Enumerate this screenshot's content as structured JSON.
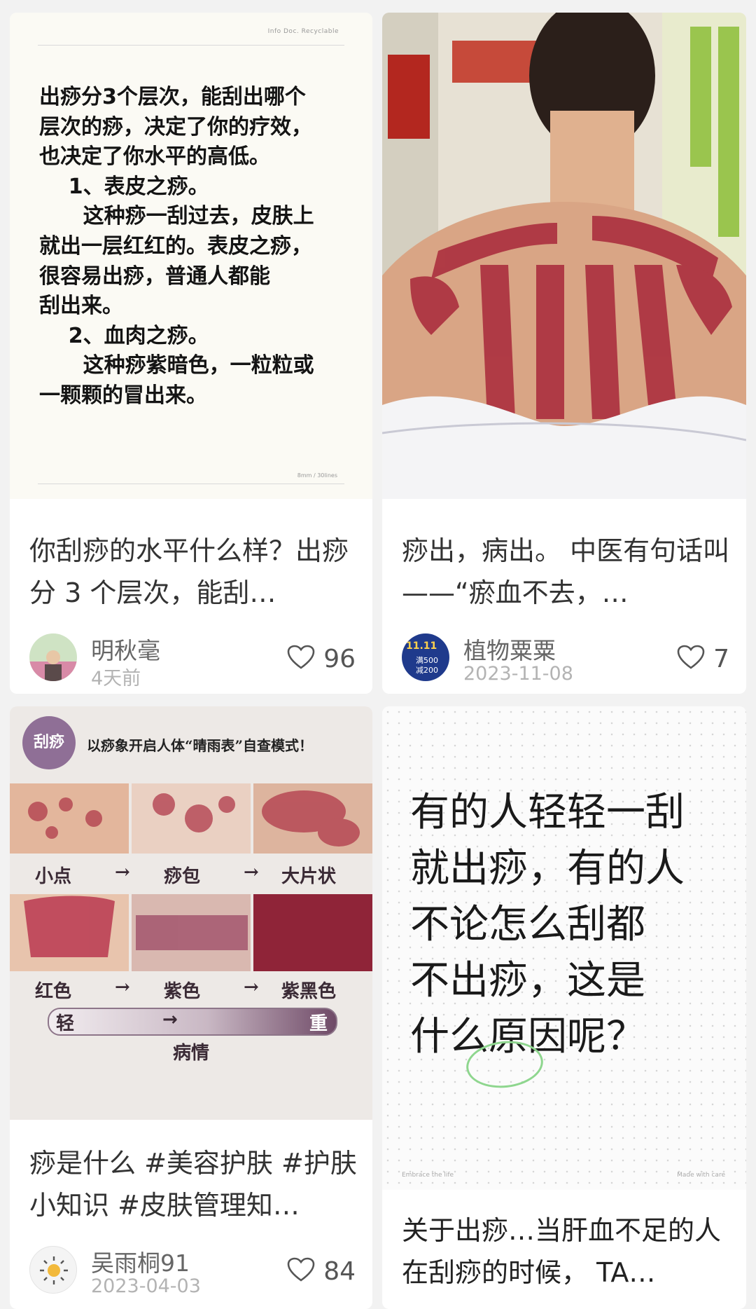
{
  "feed": [
    {
      "note_text": "出痧分3个层次，能刮出哪个\n层次的痧，决定了你的疗效，\n也决定了你水平的高低。\n    1、表皮之痧。\n      这种痧一刮过去，皮肤上\n就出一层红红的。表皮之痧，\n很容易出痧，普通人都能\n刮出来。\n    2、血肉之痧。\n      这种痧紫暗色，一粒粒或\n一颗颗的冒出来。",
      "note_top_label": "Info Doc.   Recyclable",
      "note_bottom_label": "8mm / 30lines",
      "caption": "你刮痧的水平什么样？出痧分 3 个层次，能刮…",
      "author": "明秋毫",
      "date": "4天前",
      "likes": "96"
    },
    {
      "caption": "痧出，病出。 中医有句话叫——“瘀血不去，…",
      "author": "植物粟粟",
      "date": "2023-11-08",
      "likes": "7",
      "avatar_text_1": "11.11",
      "avatar_text_2": "满500",
      "avatar_text_3": "减200"
    },
    {
      "seal_text": "刮痧",
      "info_title": "以痧象开启人体“晴雨表”自查模式！",
      "row1_labels": [
        "小点",
        "→",
        "痧包",
        "→",
        "大片状"
      ],
      "row2_labels": [
        "红色",
        "→",
        "紫色",
        "→",
        "紫黑色"
      ],
      "bar_left": "轻",
      "bar_arrow": "→",
      "bar_right": "重",
      "bar_caption": "病情",
      "caption": "痧是什么 #美容护肤 #护肤小知识 #皮肤管理知…",
      "author": "吴雨桐91",
      "date": "2023-04-03",
      "likes": "84"
    },
    {
      "note_text": "有的人轻轻一刮\n就出痧，有的人\n不论怎么刮都\n不出痧，这是\n什么原因呢？",
      "foot_left": "Embrace the life",
      "foot_right": "Made with care",
      "caption": "关于出痧…当肝血不足的人在刮痧的时候， TA…"
    }
  ],
  "colors": {
    "bruise": "#a8283a",
    "seal": "#8f6f96",
    "circle_mark": "#8ed68e"
  }
}
